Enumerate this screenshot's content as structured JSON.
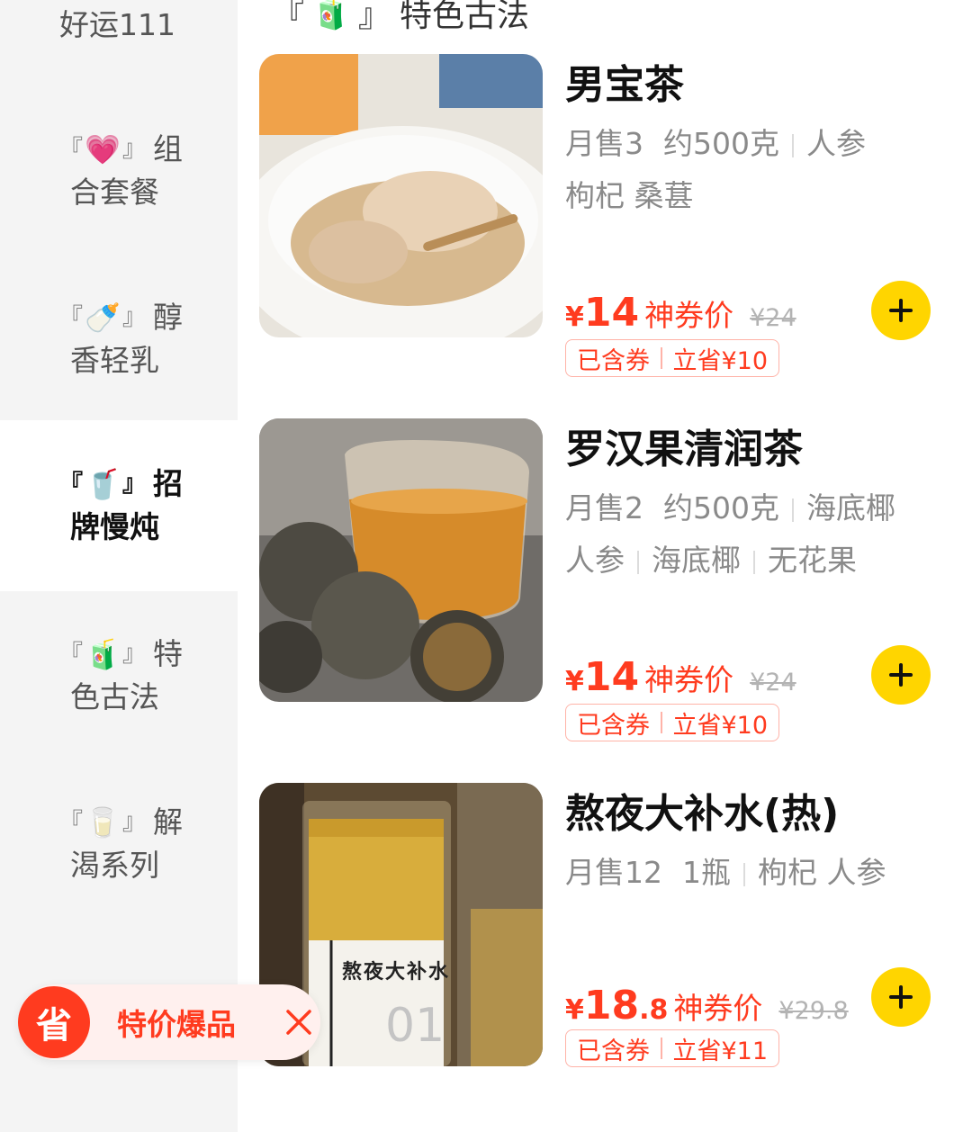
{
  "sidebar": {
    "items": [
      {
        "line1": "好运111",
        "line2": "",
        "emoji": ""
      },
      {
        "bracket_open": "『",
        "emoji": "💗",
        "bracket_close": "』",
        "line1": "组",
        "line2": "合套餐"
      },
      {
        "bracket_open": "『",
        "emoji": "🍼",
        "bracket_close": "』",
        "line1": "醇",
        "line2": "香轻乳"
      },
      {
        "bracket_open": "『",
        "emoji": "🥤",
        "bracket_close": "』",
        "line1": "招",
        "line2": "牌慢炖"
      },
      {
        "bracket_open": "『",
        "emoji": "🧃",
        "bracket_close": "』",
        "line1": "特",
        "line2": "色古法"
      },
      {
        "bracket_open": "『",
        "emoji": "🥛",
        "bracket_close": "』",
        "line1": "解",
        "line2": "渴系列"
      }
    ]
  },
  "section": {
    "bracket_open": "『",
    "emoji": "🧃",
    "bracket_close": "』",
    "title": "特色古法"
  },
  "products": [
    {
      "name": "男宝茶",
      "meta_line1": [
        "月售3",
        "约500克",
        "人参"
      ],
      "meta_line2": "枸杞 桑葚",
      "yen": "¥",
      "price_int": "14",
      "price_dec": "",
      "price_label": "神券价",
      "original_price": "¥24",
      "coupon_left": "已含券",
      "coupon_right": "立省¥10"
    },
    {
      "name": "罗汉果清润茶",
      "meta_line1": [
        "月售2",
        "约500克",
        "海底椰"
      ],
      "meta_line2_parts": [
        "人参",
        "海底椰",
        "无花果"
      ],
      "yen": "¥",
      "price_int": "14",
      "price_dec": "",
      "price_label": "神券价",
      "original_price": "¥24",
      "coupon_left": "已含券",
      "coupon_right": "立省¥10"
    },
    {
      "name": "熬夜大补水(热)",
      "meta_line1": [
        "月售12",
        "1瓶",
        "枸杞 人参"
      ],
      "yen": "¥",
      "price_int": "18",
      "price_dec": ".8",
      "price_label": "神券价",
      "original_price": "¥29.8",
      "coupon_left": "已含券",
      "coupon_right": "立省¥11",
      "bottle_label": "熬夜大补水",
      "bottle_number": "01"
    }
  ],
  "promo": {
    "badge": "省",
    "text": "特价爆品"
  },
  "colors": {
    "accent_red": "#ff3b1f",
    "add_yellow": "#ffd500",
    "sidebar_bg": "#f4f4f4"
  },
  "icons": {
    "add": "plus-icon",
    "close": "close-icon"
  }
}
